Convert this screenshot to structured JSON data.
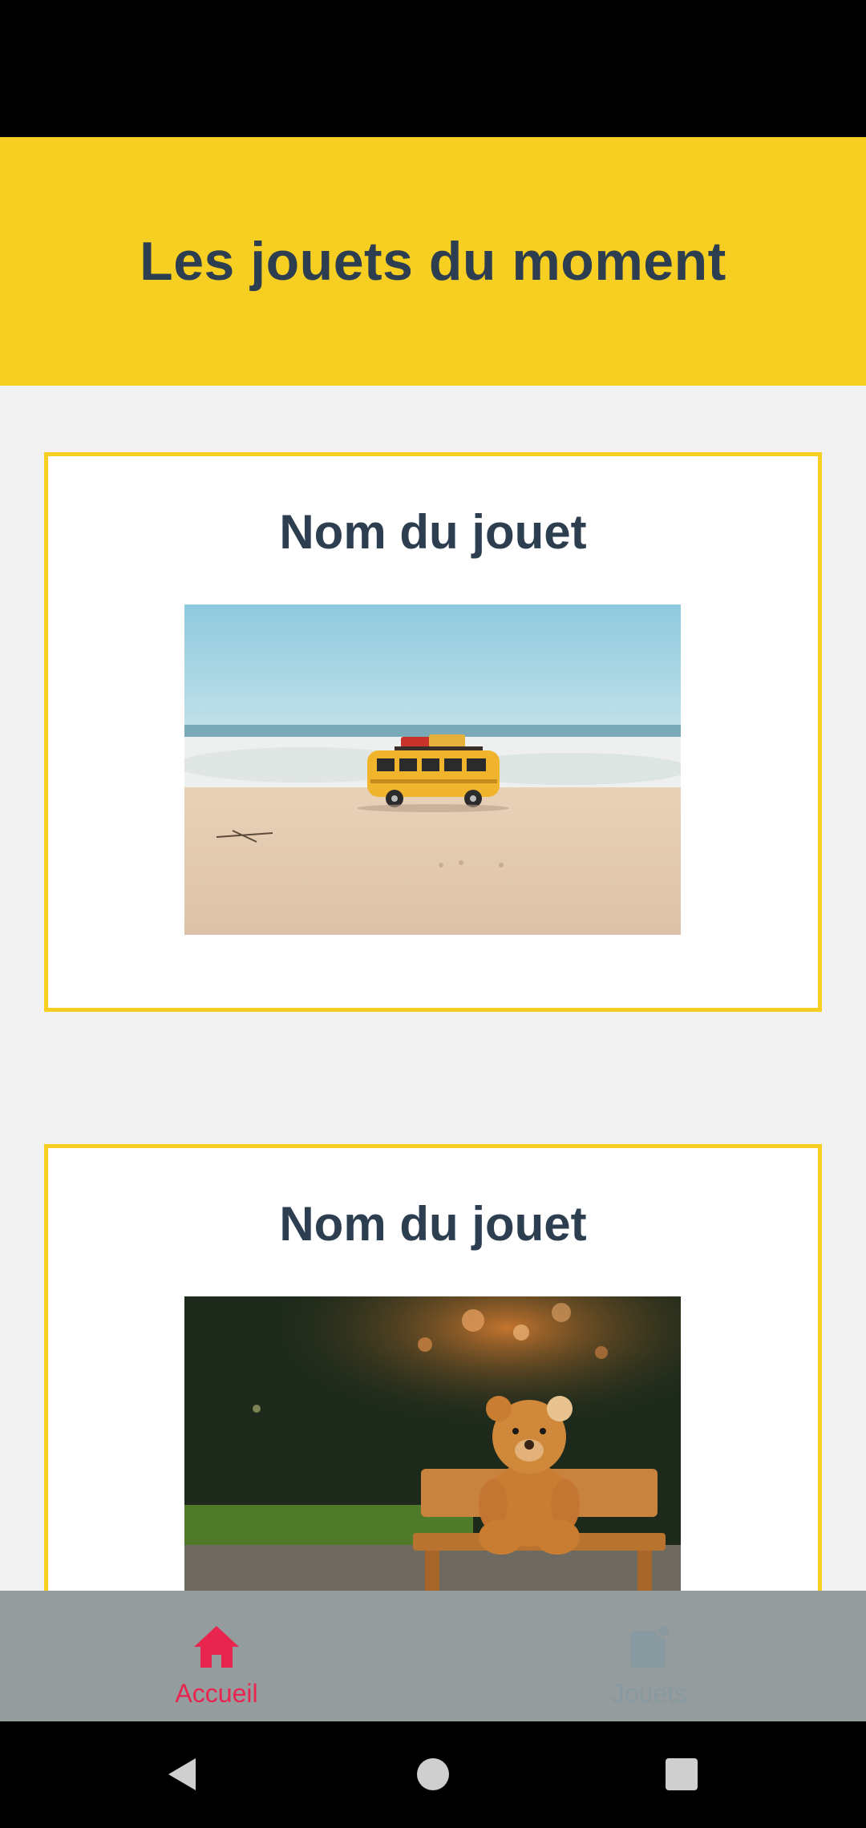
{
  "header": {
    "title": "Les jouets du moment"
  },
  "cards": [
    {
      "title": "Nom du jouet",
      "image": "toy-bus-on-beach"
    },
    {
      "title": "Nom du jouet",
      "image": "teddy-bear-on-bench"
    }
  ],
  "bottom_nav": {
    "tabs": [
      {
        "label": "Accueil",
        "icon": "home-icon",
        "active": true
      },
      {
        "label": "Jouets",
        "icon": "toy-badge-icon",
        "active": false
      }
    ]
  },
  "colors": {
    "accent": "#f7ce22",
    "title": "#2c3e50",
    "active_tab": "#e8254f",
    "inactive_tab": "#88999f",
    "nav_bar": "#959c9e"
  }
}
